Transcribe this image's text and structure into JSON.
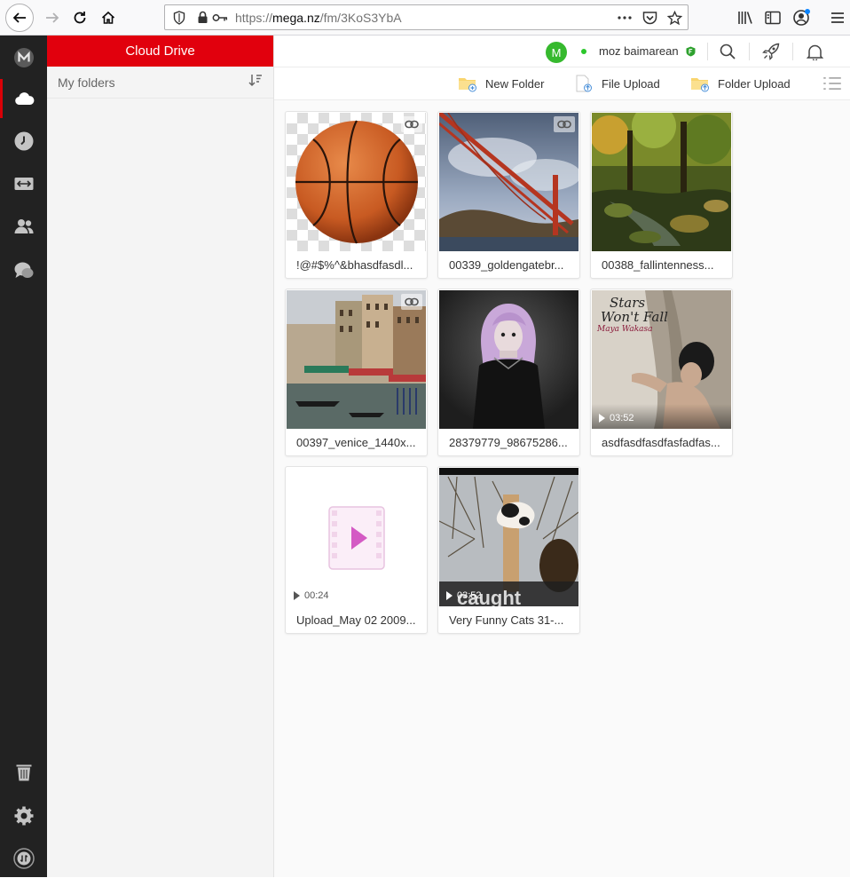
{
  "browser": {
    "url_protocol": "https://",
    "url_domain": "mega.nz",
    "url_path": "/fm/3KoS3YbA",
    "icons": [
      "back-icon",
      "forward-icon",
      "reload-icon",
      "home-icon",
      "shield-icon",
      "lock-icon",
      "key-icon",
      "more-icon",
      "pocket-icon",
      "star-icon",
      "library-icon",
      "sidebar-icon",
      "account-icon",
      "menu-icon"
    ]
  },
  "rail": {
    "items": [
      "mega-logo-icon",
      "cloud-icon",
      "recents-clock-icon",
      "transfers-icon",
      "contacts-icon",
      "chat-icon"
    ],
    "bottom": [
      "rubbish-bin-icon",
      "settings-gear-icon",
      "transfer-status-icon"
    ],
    "active": "cloud-icon"
  },
  "tree": {
    "title": "Cloud Drive",
    "my_folders_label": "My folders"
  },
  "header": {
    "avatar_letter": "M",
    "username": "moz baimarean",
    "icons": [
      "search-icon",
      "rocket-icon",
      "bell-icon"
    ],
    "colors": {
      "avatar": "#36b92e",
      "online": "#2bc72b",
      "brand_red": "#e1000d"
    }
  },
  "actions": {
    "new_folder": "New Folder",
    "file_upload": "File Upload",
    "folder_upload": "Folder Upload"
  },
  "files": [
    {
      "name": "!@#$%^&bhasdfasdl...",
      "type": "image",
      "shared_link": true
    },
    {
      "name": "00339_goldengatebr...",
      "type": "image",
      "shared_link": true
    },
    {
      "name": "00388_fallintenness...",
      "type": "image",
      "shared_link": false
    },
    {
      "name": "00397_venice_1440x...",
      "type": "image",
      "shared_link": true
    },
    {
      "name": "28379779_98675286...",
      "type": "image",
      "shared_link": false
    },
    {
      "name": "asdfasdfasdfasfadfas...",
      "type": "video",
      "duration": "03:52",
      "shared_link": false,
      "overlay_text_1": "Stars",
      "overlay_text_2": "Won't Fall",
      "overlay_text_3": "Maya Wakasa"
    },
    {
      "name": "Upload_May 02 2009...",
      "type": "video",
      "duration": "00:24",
      "shared_link": false
    },
    {
      "name": "Very Funny Cats 31-...",
      "type": "video",
      "duration": "03:52",
      "shared_link": false,
      "overlay_text_1": "caught"
    }
  ]
}
